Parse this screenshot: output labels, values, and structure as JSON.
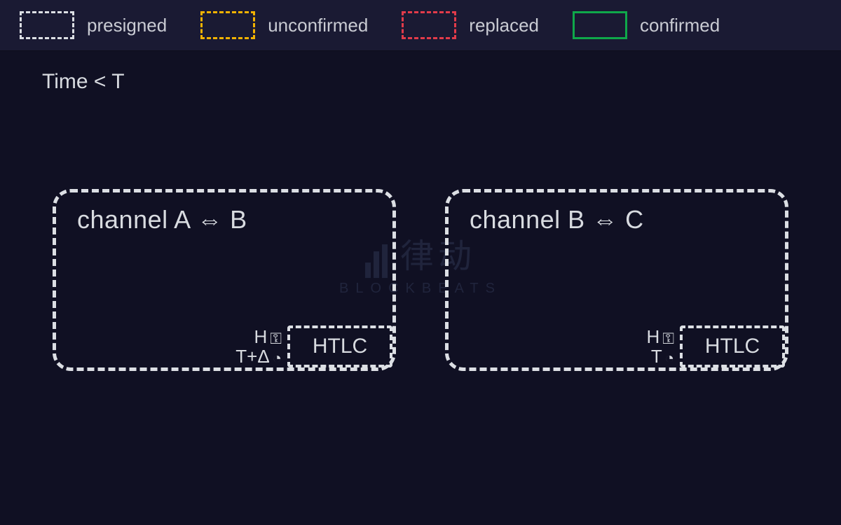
{
  "legend": {
    "presigned": {
      "label": "presigned",
      "style": "dashed-white"
    },
    "unconfirmed": {
      "label": "unconfirmed",
      "style": "dashed-orange"
    },
    "replaced": {
      "label": "replaced",
      "style": "dashed-red"
    },
    "confirmed": {
      "label": "confirmed",
      "style": "solid-green"
    }
  },
  "time_condition": "Time < T",
  "channels": {
    "ab": {
      "title": "channel A ⇔ B",
      "htlc_label": "HTLC",
      "hash_row": "H",
      "time_row": "T+Δ"
    },
    "bc": {
      "title": "channel B ⇔ C",
      "htlc_label": "HTLC",
      "hash_row": "H",
      "time_row": "T"
    }
  },
  "watermark": {
    "cn": "律动",
    "en": "BLOCKBEATS"
  },
  "colors": {
    "bg": "#101023",
    "legend_bg": "#1a1a33",
    "stroke": "#dcdfe4",
    "orange": "#f2b200",
    "red": "#e23b4a",
    "green": "#0fa84a"
  }
}
